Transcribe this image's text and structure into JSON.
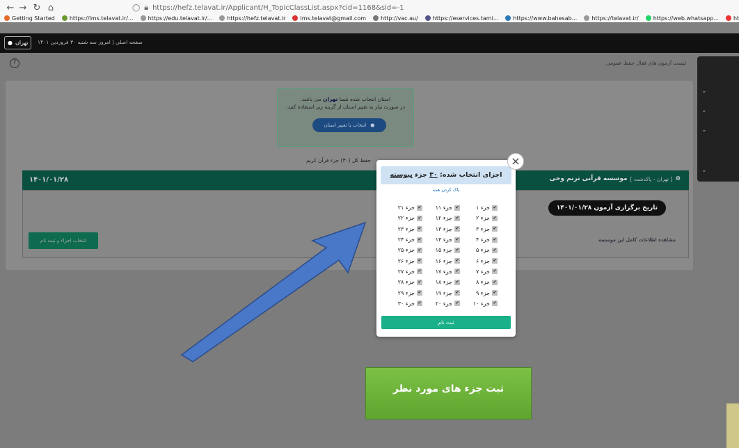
{
  "browser": {
    "url": "https://hefz.telavat.ir/Applicant/H_TopicClassList.aspx?cid=1168&sid=-1",
    "bookmarks": [
      "Getting Started",
      "https://lms.telavat.ir/...",
      "https://edu.telavat.ir/...",
      "https://hefz.telavat.ir",
      "lms.telavat@gmail.com",
      "http://vac.au/",
      "https://eservices.tami...",
      "https://www.bahesab...",
      "https://telavat.ir/",
      "https://web.whatsapp...",
      "https://kitset.ir/conver..."
    ]
  },
  "app_bar": {
    "location_button": "تهران",
    "info_text": "صفحه اصلی | امروز سه شنبه ۳۰ فروردین ۱۴۰۱"
  },
  "page": {
    "title": "لیست آزمون های فعال حفظ عمومی",
    "province_notice": {
      "line1_pre": "استان انتخاب شده شما",
      "line1_province": "تهران",
      "line1_post": "می باشد.",
      "line2": "در صورت نیاز به تغییر استان از گزینه زیر استفاده کنید.",
      "button": "انتخاب یا تغییر استان"
    },
    "quran_label": "حفظ کل (۳۰) جزء قرآن کریم",
    "institute": {
      "date": "۱۴۰۱/۰۱/۲۸",
      "location": "[ تهران - پاکدشت ]",
      "name": "موسسه قرآنی ترنم وحی",
      "exam_date": "تاریخ برگزاری آزمون ۱۴۰۱/۰۱/۲۸",
      "more_info": "مشاهده اطلاعات کامل این موسسه",
      "select_button": "انتخاب اجزاء و ثبت نام"
    }
  },
  "modal": {
    "header_pre": "اجزای انتخاب شده:",
    "header_count": "۳۰",
    "header_mid": "جزء",
    "header_status": "پیوسته",
    "clear_all": "پاک کردن همه",
    "parts": [
      "جزء ۱",
      "جزء ۱۱",
      "جزء ۲۱",
      "جزء ۲",
      "جزء ۱۲",
      "جزء ۲۲",
      "جزء ۳",
      "جزء ۱۳",
      "جزء ۲۳",
      "جزء ۴",
      "جزء ۱۴",
      "جزء ۲۴",
      "جزء ۵",
      "جزء ۱۵",
      "جزء ۲۵",
      "جزء ۶",
      "جزء ۱۶",
      "جزء ۲۶",
      "جزء ۷",
      "جزء ۱۷",
      "جزء ۲۷",
      "جزء ۸",
      "جزء ۱۸",
      "جزء ۲۸",
      "جزء ۹",
      "جزء ۱۹",
      "جزء ۲۹",
      "جزء ۱۰",
      "جزء ۲۰",
      "جزء ۳۰"
    ],
    "submit": "ثبت نام"
  },
  "annotation": {
    "callout": "ثبت جزء های مورد نظر"
  },
  "colors": {
    "teal_header": "#0a5040",
    "submit_green": "#1ab08a",
    "callout_green": "#6cb33a",
    "arrow_blue": "#4a78c8"
  }
}
